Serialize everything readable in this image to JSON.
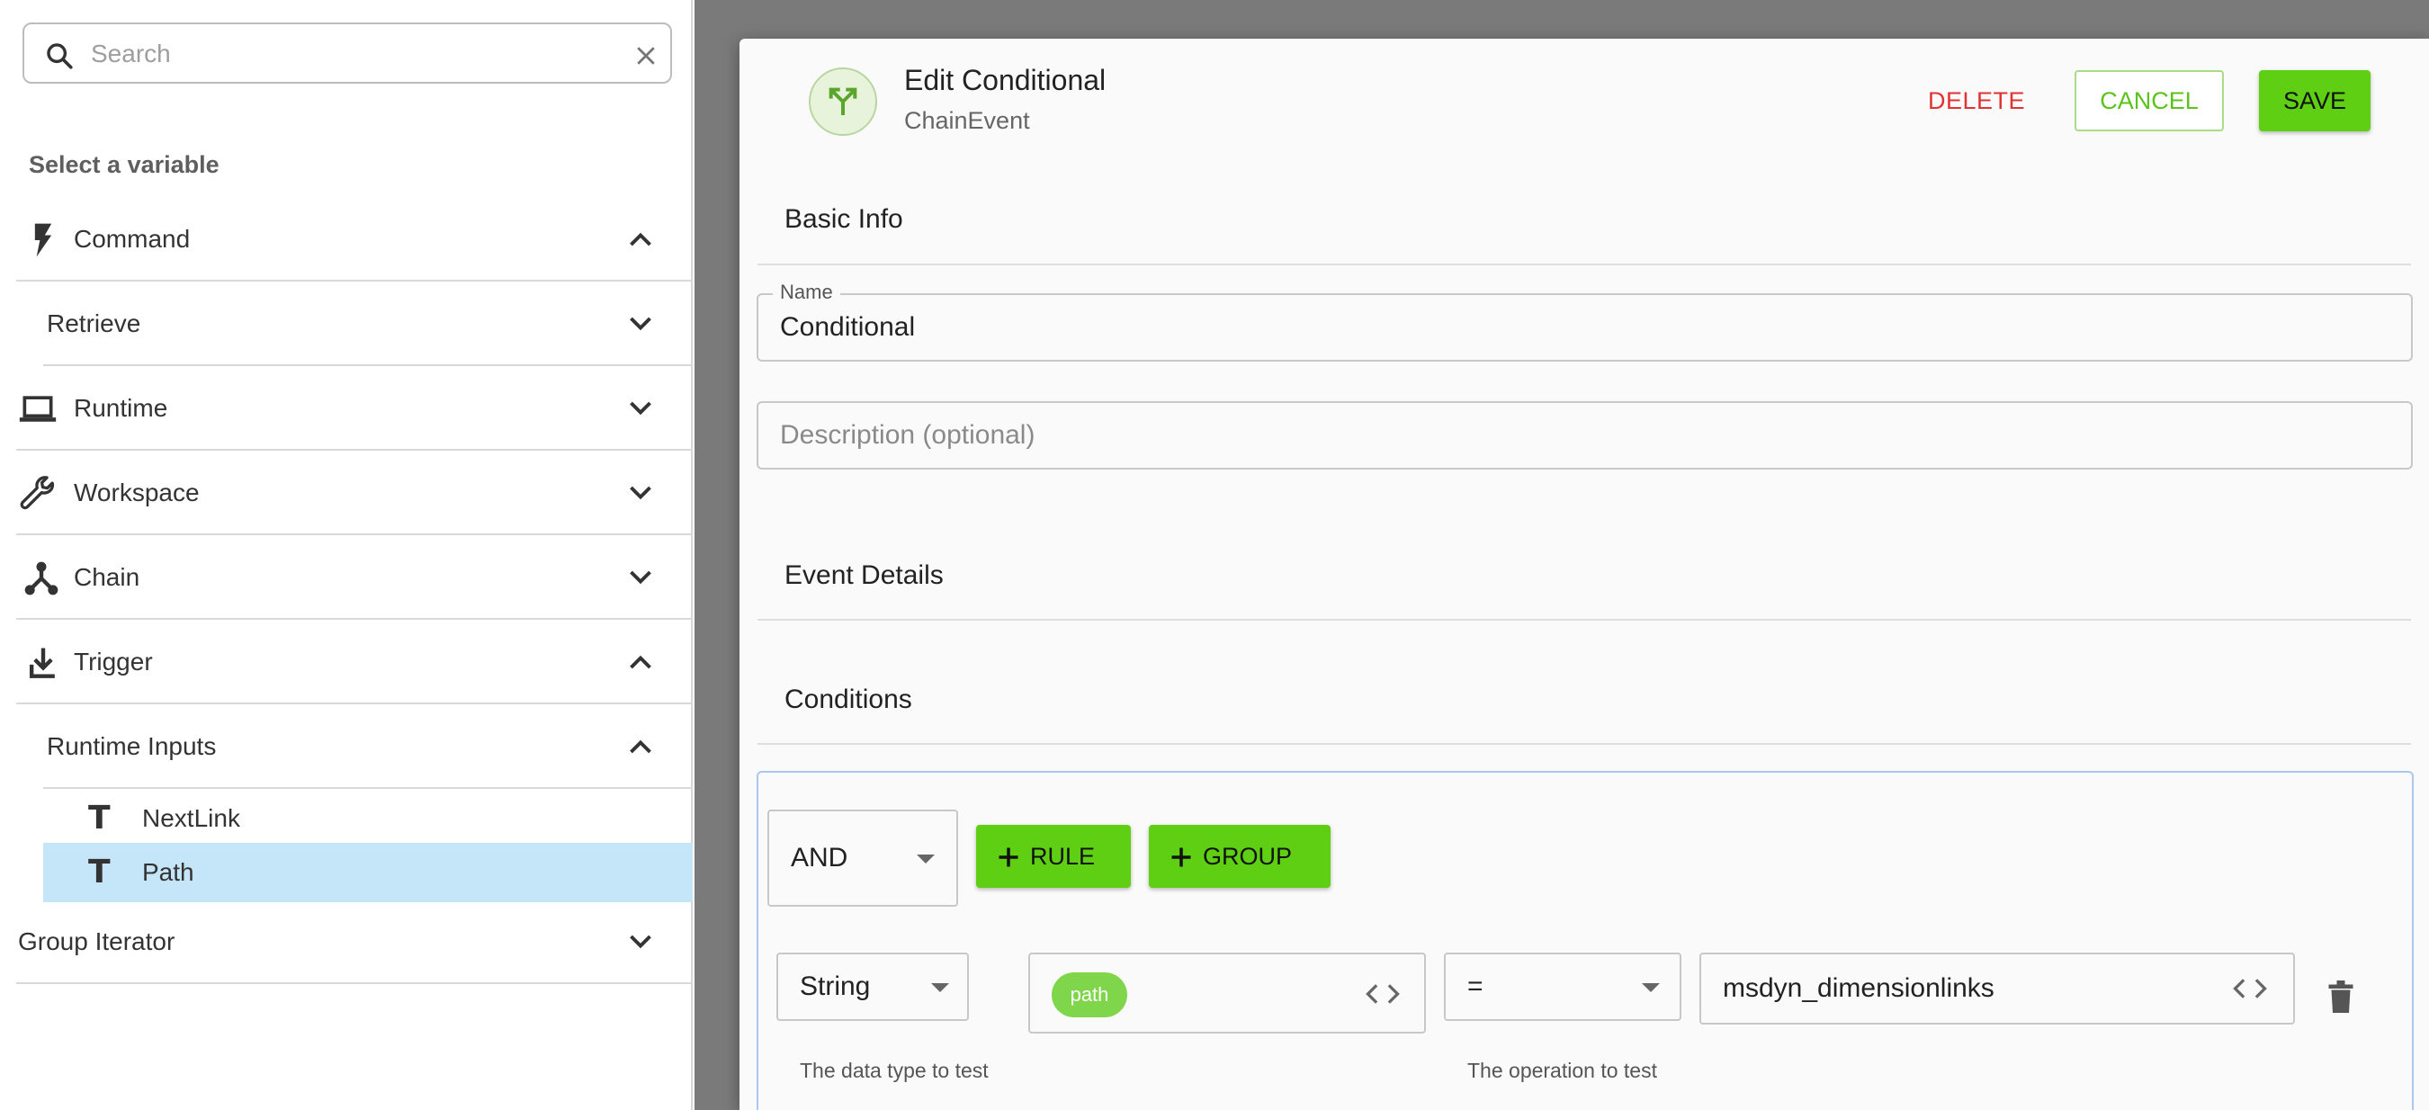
{
  "search": {
    "placeholder": "Search"
  },
  "sidebar": {
    "heading": "Select a variable",
    "items": [
      {
        "label": "Command",
        "icon": "lightning-icon",
        "expanded": true
      },
      {
        "label": "Retrieve",
        "expanded": false
      },
      {
        "label": "Runtime",
        "icon": "laptop-icon",
        "expanded": false
      },
      {
        "label": "Workspace",
        "icon": "wrench-icon",
        "expanded": false
      },
      {
        "label": "Chain",
        "icon": "chain-icon",
        "expanded": false
      },
      {
        "label": "Trigger",
        "icon": "download-icon",
        "expanded": true
      },
      {
        "label": "Runtime Inputs",
        "expanded": true
      },
      {
        "label": "Group Iterator",
        "expanded": false
      }
    ],
    "leaves": [
      {
        "label": "NextLink",
        "type_icon": "T",
        "selected": false
      },
      {
        "label": "Path",
        "type_icon": "T",
        "selected": true
      }
    ]
  },
  "dialog": {
    "title": "Edit Conditional",
    "subtitle": "ChainEvent",
    "delete_label": "DELETE",
    "cancel_label": "CANCEL",
    "save_label": "SAVE",
    "sections": {
      "basic_info": "Basic Info",
      "event_details": "Event Details",
      "conditions": "Conditions"
    },
    "name_field": {
      "label": "Name",
      "value": "Conditional"
    },
    "description_field": {
      "placeholder": "Description (optional)",
      "value": ""
    }
  },
  "rule_builder": {
    "combinator": "AND",
    "add_rule_label": "RULE",
    "add_group_label": "GROUP",
    "rule": {
      "data_type": "String",
      "data_type_helper": "The data type to test",
      "variable_chip": "path",
      "operator": "=",
      "operator_helper": "The operation to test",
      "value": "msdyn_dimensionlinks"
    }
  },
  "colors": {
    "primary_green": "#5ecf12",
    "delete_red": "#e03333",
    "selected_row": "#c5e5f9",
    "chip_green": "#7fd64a",
    "backdrop": "#7a7a7a"
  }
}
